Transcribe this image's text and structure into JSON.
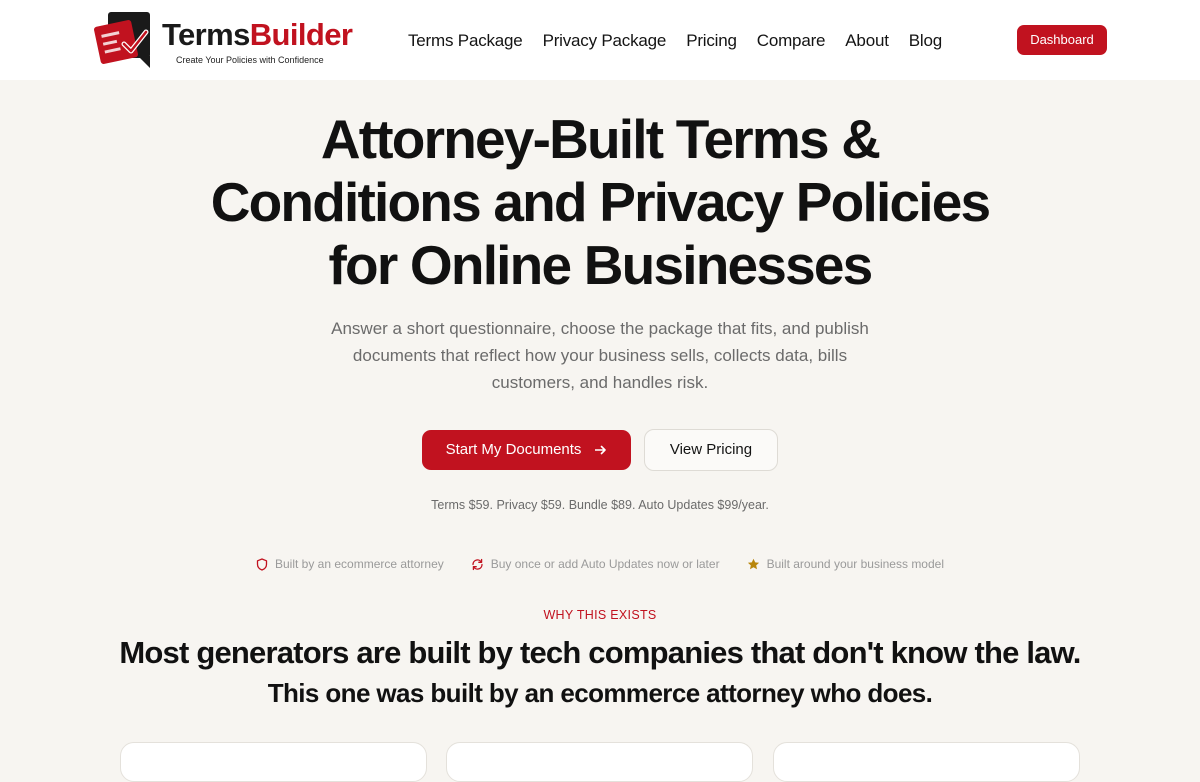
{
  "brand": {
    "name_part1": "Terms",
    "name_part2": "Builder",
    "tagline": "Create Your Policies with Confidence",
    "accent_color": "#c1121f"
  },
  "nav": {
    "items": [
      {
        "label": "Terms Package"
      },
      {
        "label": "Privacy Package"
      },
      {
        "label": "Pricing"
      },
      {
        "label": "Compare"
      },
      {
        "label": "About"
      },
      {
        "label": "Blog"
      }
    ],
    "dashboard_label": "Dashboard"
  },
  "hero": {
    "title": "Attorney-Built Terms & Conditions and Privacy Policies for Online Businesses",
    "subtitle": "Answer a short questionnaire, choose the package that fits, and publish documents that reflect how your business sells, collects data, bills customers, and handles risk.",
    "cta_primary": "Start My Documents",
    "cta_primary_icon": "arrow-right-icon",
    "cta_secondary": "View Pricing",
    "price_line": "Terms $59. Privacy $59. Bundle $89. Auto Updates $99/year."
  },
  "trust": {
    "items": [
      {
        "icon": "shield-icon",
        "label": "Built by an ecommerce attorney"
      },
      {
        "icon": "refresh-icon",
        "label": "Buy once or add Auto Updates now or later"
      },
      {
        "icon": "star-icon",
        "label": "Built around your business model"
      }
    ]
  },
  "why": {
    "eyebrow": "WHY THIS EXISTS",
    "title": "Most generators are built by tech companies that don't know the law.",
    "subtitle": "This one was built by an ecommerce attorney who does."
  }
}
